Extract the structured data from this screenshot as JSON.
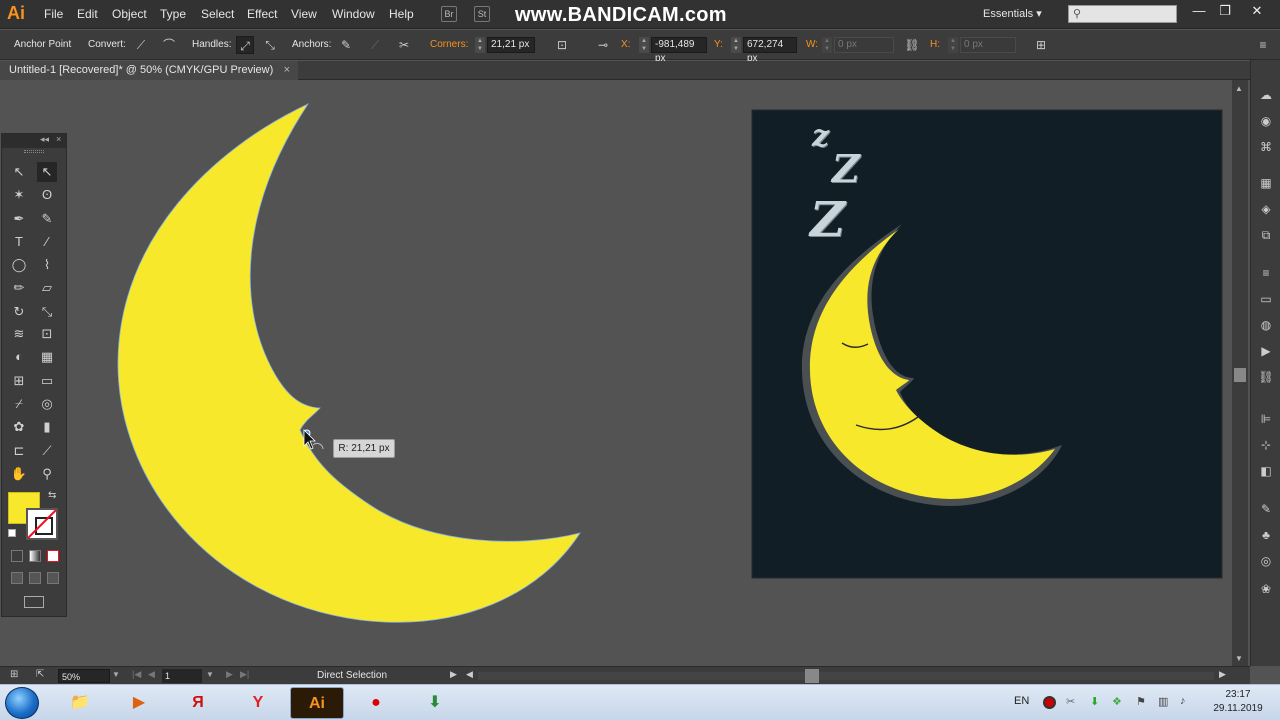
{
  "app": {
    "logo": "Ai"
  },
  "menu": [
    "File",
    "Edit",
    "Object",
    "Type",
    "Select",
    "Effect",
    "View",
    "Window",
    "Help"
  ],
  "menu_buttons": {
    "br_label": "Br",
    "st_label": "St"
  },
  "watermark": "www.BANDICAM.com",
  "workspace": {
    "label": "Essentials",
    "arrow": "▾"
  },
  "window_controls": {
    "min": "—",
    "restore": "❐",
    "close": "✕"
  },
  "control_bar": {
    "mode_label": "Anchor Point",
    "convert_label": "Convert:",
    "handles_label": "Handles:",
    "anchors_label": "Anchors:",
    "corners_label": "Corners:",
    "corners_value": "21,21 px",
    "x_label": "X:",
    "x_value": "-981,489 px",
    "y_label": "Y:",
    "y_value": "672,274 px",
    "w_label": "W:",
    "w_value": "0 px",
    "h_label": "H:",
    "h_value": "0 px"
  },
  "document_tab": {
    "title": "Untitled-1 [Recovered]* @ 50% (CMYK/GPU Preview)",
    "close": "×"
  },
  "tooltip": "R: 21,21 px",
  "artwork_colors": {
    "moon": "#f7e82b",
    "bg_dark": "#121e26",
    "outline": "#4a4f52",
    "zzz": "#c8d4da"
  },
  "zzz_text": [
    "z",
    "Z",
    "Z"
  ],
  "toolbox": {
    "header_collapse": "◂◂",
    "header_close": "×",
    "tools": [
      {
        "name": "selection-tool-icon",
        "glyph": "↖"
      },
      {
        "name": "direct-selection-tool-icon",
        "glyph": "↖"
      },
      {
        "name": "magic-wand-tool-icon",
        "glyph": "✶"
      },
      {
        "name": "lasso-tool-icon",
        "glyph": "ʘ"
      },
      {
        "name": "pen-tool-icon",
        "glyph": "✒"
      },
      {
        "name": "curvature-tool-icon",
        "glyph": "✎"
      },
      {
        "name": "type-tool-icon",
        "glyph": "T"
      },
      {
        "name": "line-tool-icon",
        "glyph": "⁄"
      },
      {
        "name": "ellipse-tool-icon",
        "glyph": "◯"
      },
      {
        "name": "paintbrush-tool-icon",
        "glyph": "⌇"
      },
      {
        "name": "pencil-tool-icon",
        "glyph": "✏"
      },
      {
        "name": "eraser-tool-icon",
        "glyph": "▱"
      },
      {
        "name": "rotate-tool-icon",
        "glyph": "↻"
      },
      {
        "name": "scale-tool-icon",
        "glyph": "⤡"
      },
      {
        "name": "warp-tool-icon",
        "glyph": "≋"
      },
      {
        "name": "free-transform-tool-icon",
        "glyph": "⊡"
      },
      {
        "name": "shape-builder-tool-icon",
        "glyph": "◐"
      },
      {
        "name": "perspective-grid-tool-icon",
        "glyph": "▦"
      },
      {
        "name": "mesh-tool-icon",
        "glyph": "⊞"
      },
      {
        "name": "gradient-tool-icon",
        "glyph": "▭"
      },
      {
        "name": "eyedropper-tool-icon",
        "glyph": "⌿"
      },
      {
        "name": "blend-tool-icon",
        "glyph": "◎"
      },
      {
        "name": "symbol-sprayer-tool-icon",
        "glyph": "✿"
      },
      {
        "name": "column-graph-tool-icon",
        "glyph": "▮"
      },
      {
        "name": "artboard-tool-icon",
        "glyph": "⊏"
      },
      {
        "name": "slice-tool-icon",
        "glyph": "⟋"
      },
      {
        "name": "hand-tool-icon",
        "glyph": "✋"
      },
      {
        "name": "zoom-tool-icon",
        "glyph": "⚲"
      }
    ]
  },
  "swatches": {
    "fill": "#f7e82b",
    "swap": "⇆"
  },
  "status": {
    "zoom": "50%",
    "page": "1",
    "tool": "Direct Selection"
  },
  "panel_icons": [
    "cc-libraries-icon",
    "color-icon",
    "color-guide-icon",
    "swatches-icon",
    "layers-icon",
    "artboards-icon",
    "stroke-icon",
    "gradient-icon",
    "transparency-icon",
    "actions-icon",
    "links-icon",
    "align-icon",
    "transform-icon",
    "pathfinder-icon",
    "brushes-icon",
    "symbols-icon",
    "graphic-styles-icon",
    "appearance-icon"
  ],
  "taskbar": {
    "apps": [
      {
        "name": "explorer",
        "glyph": "📁"
      },
      {
        "name": "media-player",
        "glyph": "▶"
      },
      {
        "name": "yandex",
        "glyph": "Я"
      },
      {
        "name": "yandex-browser",
        "glyph": "Y"
      },
      {
        "name": "illustrator",
        "glyph": "Ai"
      },
      {
        "name": "bandicam",
        "glyph": "●"
      },
      {
        "name": "download-manager",
        "glyph": "⬇"
      }
    ],
    "lang": "EN",
    "time": "23:17",
    "date": "29.11.2019"
  }
}
